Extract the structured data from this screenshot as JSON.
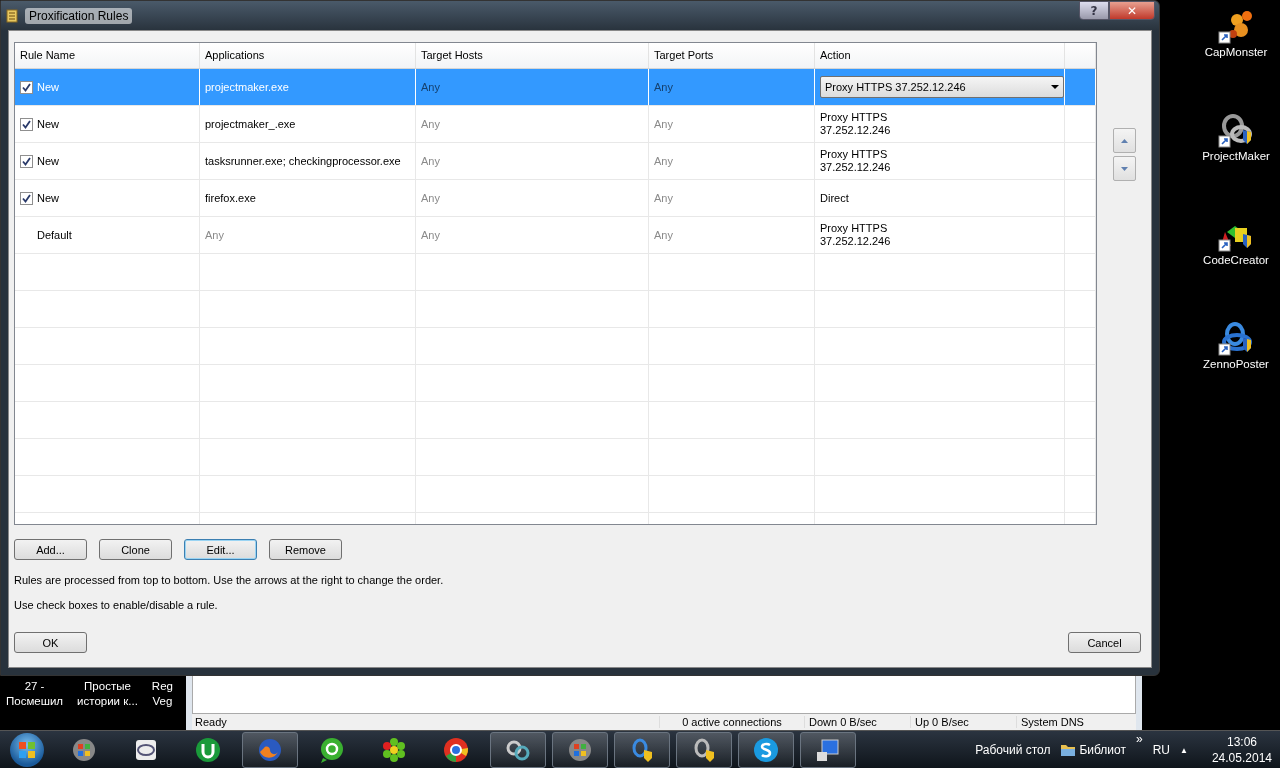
{
  "dialog": {
    "title": "Proxification Rules",
    "help_button": "?",
    "close_button": "✕"
  },
  "table": {
    "columns": [
      "Rule Name",
      "Applications",
      "Target Hosts",
      "Target Ports",
      "Action"
    ],
    "rows": [
      {
        "kind": "rule",
        "enabled": true,
        "selected": true,
        "name": "New",
        "applications": "projectmaker.exe",
        "target_hosts": "Any",
        "target_ports": "Any",
        "action": "Proxy HTTPS 37.252.12.246"
      },
      {
        "kind": "rule",
        "enabled": true,
        "selected": false,
        "name": "New",
        "applications": "projectmaker_.exe",
        "target_hosts": "Any",
        "target_ports": "Any",
        "action": "Proxy HTTPS\n37.252.12.246"
      },
      {
        "kind": "rule",
        "enabled": true,
        "selected": false,
        "name": "New",
        "applications": "tasksrunner.exe; checkingprocessor.exe",
        "target_hosts": "Any",
        "target_ports": "Any",
        "action": "Proxy HTTPS\n37.252.12.246"
      },
      {
        "kind": "rule",
        "enabled": true,
        "selected": false,
        "name": "New",
        "applications": "firefox.exe",
        "target_hosts": "Any",
        "target_ports": "Any",
        "action": "Direct"
      },
      {
        "kind": "default",
        "selected": false,
        "name": "Default",
        "applications": "Any",
        "target_hosts": "Any",
        "target_ports": "Any",
        "action": "Proxy HTTPS\n37.252.12.246"
      }
    ]
  },
  "rule_buttons": [
    {
      "label": "Add...",
      "focused": false
    },
    {
      "label": "Clone",
      "focused": false
    },
    {
      "label": "Edit...",
      "focused": true
    },
    {
      "label": "Remove",
      "focused": false
    }
  ],
  "hints": [
    "Rules are processed from top to bottom. Use the arrows at the right to change the order.",
    "Use check boxes to enable/disable a rule."
  ],
  "ok_button": "OK",
  "cancel_button": "Cancel",
  "video_list": [
    "27 -\nПосмешил",
    "Простые\nистории к...",
    "Reg\nVeg"
  ],
  "status_bar": [
    "Ready",
    "0 active connections",
    "Down 0 B/sec",
    "Up 0 B/sec",
    "System DNS"
  ],
  "desktop_icons": [
    "CapMonster",
    "ProjectMaker",
    "CodeCreator",
    "ZennoPoster"
  ],
  "taskbar": {
    "buttons": [
      {
        "running": false
      },
      {
        "running": false
      },
      {
        "running": false
      },
      {
        "running": true
      },
      {
        "running": false
      },
      {
        "running": false
      },
      {
        "running": false
      },
      {
        "running": true
      },
      {
        "running": true
      },
      {
        "running": true
      },
      {
        "running": true
      },
      {
        "running": true
      },
      {
        "running": true
      }
    ],
    "toolbars": [
      "Рабочий стол",
      "Библиот"
    ],
    "more": "»",
    "language": "RU",
    "tray_arrow": "▲",
    "time": "13:06",
    "date": "24.05.2014"
  }
}
